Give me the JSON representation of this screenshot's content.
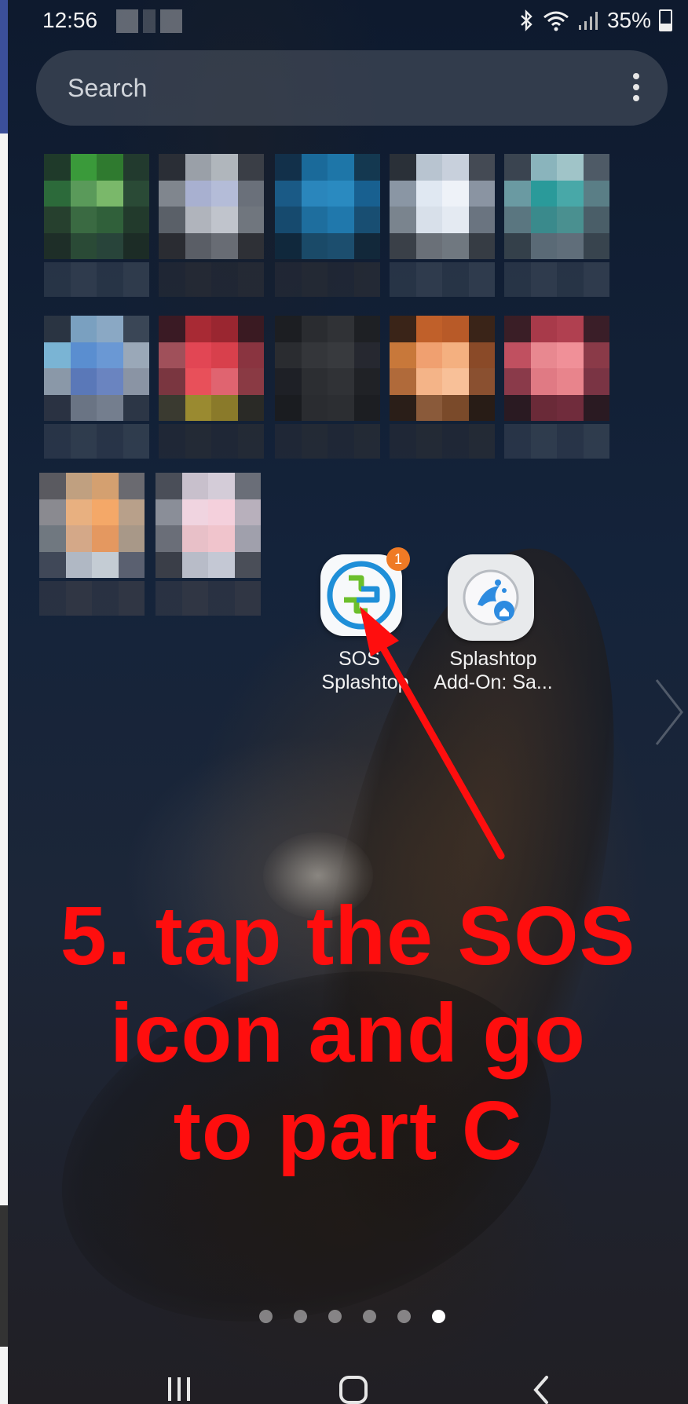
{
  "status_bar": {
    "time": "12:56",
    "battery": "35%",
    "icons": [
      "bluetooth-icon",
      "wifi-icon",
      "signal-icon",
      "battery-icon"
    ]
  },
  "search": {
    "placeholder": "Search",
    "menu_icon": "more-vertical-icon"
  },
  "apps": [
    {
      "name": "SOS - Splashtop",
      "label_line1": "SOS -",
      "label_line2": "Splashtop",
      "badge": "1",
      "icon": "sos-splashtop-icon"
    },
    {
      "name": "Splashtop Add-On: Sa...",
      "label_line1": "Splashtop",
      "label_line2": "Add-On: Sa...",
      "icon": "splashtop-addon-icon"
    }
  ],
  "annotation": {
    "line1": "5. tap the SOS",
    "line2": "icon and go",
    "line3": "to part C",
    "color": "#ff0e0e"
  },
  "page_indicator": {
    "total_pages": 6,
    "current_page": 6
  },
  "nav_bar": {
    "buttons": [
      "recent-apps-icon",
      "home-icon",
      "back-icon"
    ]
  },
  "colors": {
    "sos_blue": "#1f8fd8",
    "sos_green": "#6cbf2c",
    "badge_orange": "#ef7a25",
    "splashtop_blue": "#2d8be0"
  }
}
